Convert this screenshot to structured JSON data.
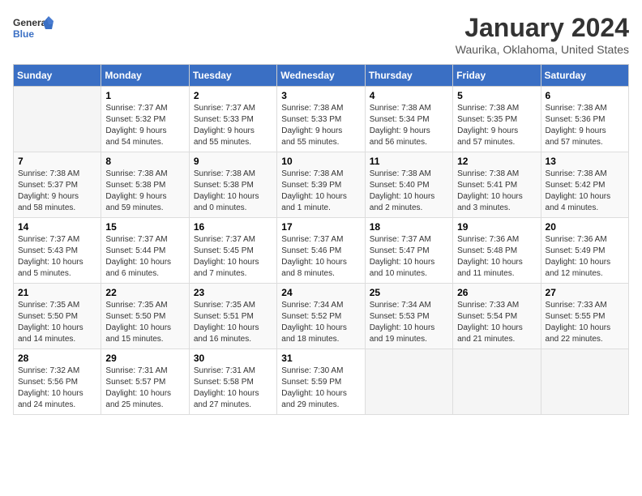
{
  "header": {
    "logo_line1": "General",
    "logo_line2": "Blue",
    "month_title": "January 2024",
    "location": "Waurika, Oklahoma, United States"
  },
  "days_of_week": [
    "Sunday",
    "Monday",
    "Tuesday",
    "Wednesday",
    "Thursday",
    "Friday",
    "Saturday"
  ],
  "weeks": [
    [
      {
        "num": "",
        "data": []
      },
      {
        "num": "1",
        "data": [
          "Sunrise: 7:37 AM",
          "Sunset: 5:32 PM",
          "Daylight: 9 hours",
          "and 54 minutes."
        ]
      },
      {
        "num": "2",
        "data": [
          "Sunrise: 7:37 AM",
          "Sunset: 5:33 PM",
          "Daylight: 9 hours",
          "and 55 minutes."
        ]
      },
      {
        "num": "3",
        "data": [
          "Sunrise: 7:38 AM",
          "Sunset: 5:33 PM",
          "Daylight: 9 hours",
          "and 55 minutes."
        ]
      },
      {
        "num": "4",
        "data": [
          "Sunrise: 7:38 AM",
          "Sunset: 5:34 PM",
          "Daylight: 9 hours",
          "and 56 minutes."
        ]
      },
      {
        "num": "5",
        "data": [
          "Sunrise: 7:38 AM",
          "Sunset: 5:35 PM",
          "Daylight: 9 hours",
          "and 57 minutes."
        ]
      },
      {
        "num": "6",
        "data": [
          "Sunrise: 7:38 AM",
          "Sunset: 5:36 PM",
          "Daylight: 9 hours",
          "and 57 minutes."
        ]
      }
    ],
    [
      {
        "num": "7",
        "data": [
          "Sunrise: 7:38 AM",
          "Sunset: 5:37 PM",
          "Daylight: 9 hours",
          "and 58 minutes."
        ]
      },
      {
        "num": "8",
        "data": [
          "Sunrise: 7:38 AM",
          "Sunset: 5:38 PM",
          "Daylight: 9 hours",
          "and 59 minutes."
        ]
      },
      {
        "num": "9",
        "data": [
          "Sunrise: 7:38 AM",
          "Sunset: 5:38 PM",
          "Daylight: 10 hours",
          "and 0 minutes."
        ]
      },
      {
        "num": "10",
        "data": [
          "Sunrise: 7:38 AM",
          "Sunset: 5:39 PM",
          "Daylight: 10 hours",
          "and 1 minute."
        ]
      },
      {
        "num": "11",
        "data": [
          "Sunrise: 7:38 AM",
          "Sunset: 5:40 PM",
          "Daylight: 10 hours",
          "and 2 minutes."
        ]
      },
      {
        "num": "12",
        "data": [
          "Sunrise: 7:38 AM",
          "Sunset: 5:41 PM",
          "Daylight: 10 hours",
          "and 3 minutes."
        ]
      },
      {
        "num": "13",
        "data": [
          "Sunrise: 7:38 AM",
          "Sunset: 5:42 PM",
          "Daylight: 10 hours",
          "and 4 minutes."
        ]
      }
    ],
    [
      {
        "num": "14",
        "data": [
          "Sunrise: 7:37 AM",
          "Sunset: 5:43 PM",
          "Daylight: 10 hours",
          "and 5 minutes."
        ]
      },
      {
        "num": "15",
        "data": [
          "Sunrise: 7:37 AM",
          "Sunset: 5:44 PM",
          "Daylight: 10 hours",
          "and 6 minutes."
        ]
      },
      {
        "num": "16",
        "data": [
          "Sunrise: 7:37 AM",
          "Sunset: 5:45 PM",
          "Daylight: 10 hours",
          "and 7 minutes."
        ]
      },
      {
        "num": "17",
        "data": [
          "Sunrise: 7:37 AM",
          "Sunset: 5:46 PM",
          "Daylight: 10 hours",
          "and 8 minutes."
        ]
      },
      {
        "num": "18",
        "data": [
          "Sunrise: 7:37 AM",
          "Sunset: 5:47 PM",
          "Daylight: 10 hours",
          "and 10 minutes."
        ]
      },
      {
        "num": "19",
        "data": [
          "Sunrise: 7:36 AM",
          "Sunset: 5:48 PM",
          "Daylight: 10 hours",
          "and 11 minutes."
        ]
      },
      {
        "num": "20",
        "data": [
          "Sunrise: 7:36 AM",
          "Sunset: 5:49 PM",
          "Daylight: 10 hours",
          "and 12 minutes."
        ]
      }
    ],
    [
      {
        "num": "21",
        "data": [
          "Sunrise: 7:35 AM",
          "Sunset: 5:50 PM",
          "Daylight: 10 hours",
          "and 14 minutes."
        ]
      },
      {
        "num": "22",
        "data": [
          "Sunrise: 7:35 AM",
          "Sunset: 5:50 PM",
          "Daylight: 10 hours",
          "and 15 minutes."
        ]
      },
      {
        "num": "23",
        "data": [
          "Sunrise: 7:35 AM",
          "Sunset: 5:51 PM",
          "Daylight: 10 hours",
          "and 16 minutes."
        ]
      },
      {
        "num": "24",
        "data": [
          "Sunrise: 7:34 AM",
          "Sunset: 5:52 PM",
          "Daylight: 10 hours",
          "and 18 minutes."
        ]
      },
      {
        "num": "25",
        "data": [
          "Sunrise: 7:34 AM",
          "Sunset: 5:53 PM",
          "Daylight: 10 hours",
          "and 19 minutes."
        ]
      },
      {
        "num": "26",
        "data": [
          "Sunrise: 7:33 AM",
          "Sunset: 5:54 PM",
          "Daylight: 10 hours",
          "and 21 minutes."
        ]
      },
      {
        "num": "27",
        "data": [
          "Sunrise: 7:33 AM",
          "Sunset: 5:55 PM",
          "Daylight: 10 hours",
          "and 22 minutes."
        ]
      }
    ],
    [
      {
        "num": "28",
        "data": [
          "Sunrise: 7:32 AM",
          "Sunset: 5:56 PM",
          "Daylight: 10 hours",
          "and 24 minutes."
        ]
      },
      {
        "num": "29",
        "data": [
          "Sunrise: 7:31 AM",
          "Sunset: 5:57 PM",
          "Daylight: 10 hours",
          "and 25 minutes."
        ]
      },
      {
        "num": "30",
        "data": [
          "Sunrise: 7:31 AM",
          "Sunset: 5:58 PM",
          "Daylight: 10 hours",
          "and 27 minutes."
        ]
      },
      {
        "num": "31",
        "data": [
          "Sunrise: 7:30 AM",
          "Sunset: 5:59 PM",
          "Daylight: 10 hours",
          "and 29 minutes."
        ]
      },
      {
        "num": "",
        "data": []
      },
      {
        "num": "",
        "data": []
      },
      {
        "num": "",
        "data": []
      }
    ]
  ]
}
